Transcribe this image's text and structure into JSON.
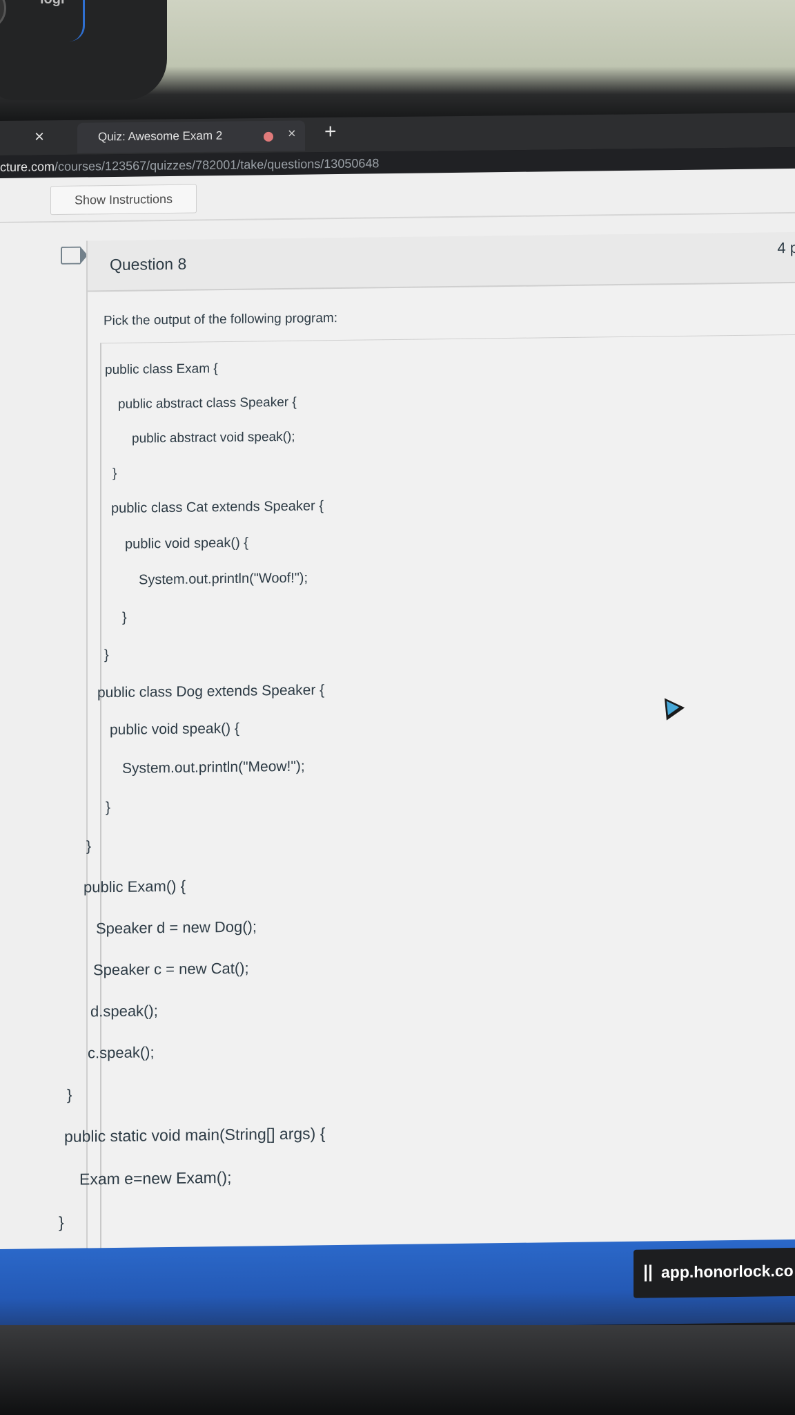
{
  "webcam": {
    "logo": "logi"
  },
  "browser": {
    "tab_title": "Quiz: Awesome Exam 2",
    "close_glyph": "×",
    "new_tab_glyph": "+",
    "url_host": "cture.com",
    "url_path": "/courses/123567/quizzes/782001/take/questions/13050648"
  },
  "page": {
    "show_instructions_label": "Show Instructions",
    "question": {
      "title": "Question 8",
      "points": "4 p",
      "prompt": "Pick the output of the following program:",
      "code_lines": [
        "public class Exam {",
        "public abstract class Speaker {",
        "public abstract void speak();",
        "}",
        "public class Cat extends Speaker {",
        "public void speak() {",
        "System.out.println(\"Woof!\");",
        "}",
        "}",
        "public class Dog extends Speaker {",
        "public void speak() {",
        "System.out.println(\"Meow!\");",
        "}",
        "}",
        "public Exam() {",
        "Speaker d = new Dog();",
        "Speaker c = new Cat();",
        "d.speak();",
        "c.speak();",
        "}",
        "public static void main(String[] args) {",
        "Exam e=new Exam();",
        "}"
      ]
    }
  },
  "proctor": {
    "label": "app.honorlock.co"
  },
  "colors": {
    "accent_blue": "#2b68c9",
    "text": "#2d3b45",
    "page_bg": "#efefef"
  }
}
